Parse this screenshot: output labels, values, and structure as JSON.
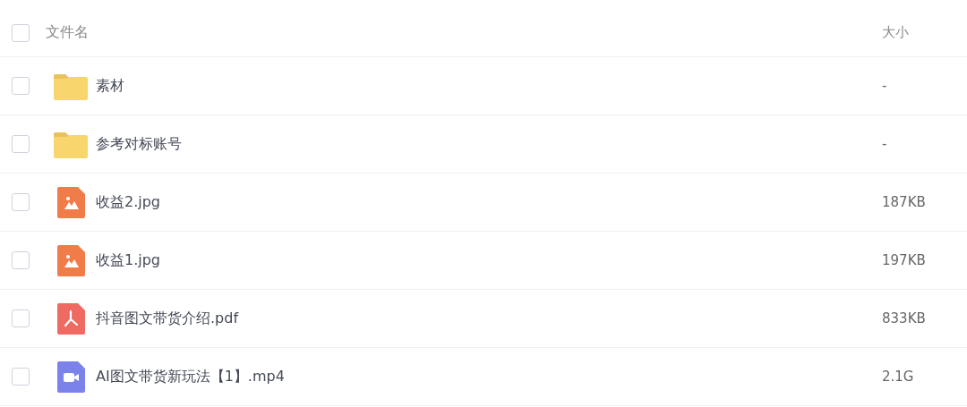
{
  "table": {
    "select_all": {
      "checked": false
    },
    "columns": [
      "文件名",
      "大小"
    ],
    "rows": [
      {
        "kind": "folder",
        "name": "素材",
        "size": "-",
        "checked": false
      },
      {
        "kind": "folder",
        "name": "参考对标账号",
        "size": "-",
        "checked": false
      },
      {
        "kind": "image",
        "name": "收益2.jpg",
        "size": "187KB",
        "checked": false
      },
      {
        "kind": "image",
        "name": "收益1.jpg",
        "size": "197KB",
        "checked": false
      },
      {
        "kind": "pdf",
        "name": "抖音图文带货介绍.pdf",
        "size": "833KB",
        "checked": false
      },
      {
        "kind": "video",
        "name": "AI图文带货新玩法【1】.mp4",
        "size": "2.1G",
        "checked": false
      }
    ]
  }
}
